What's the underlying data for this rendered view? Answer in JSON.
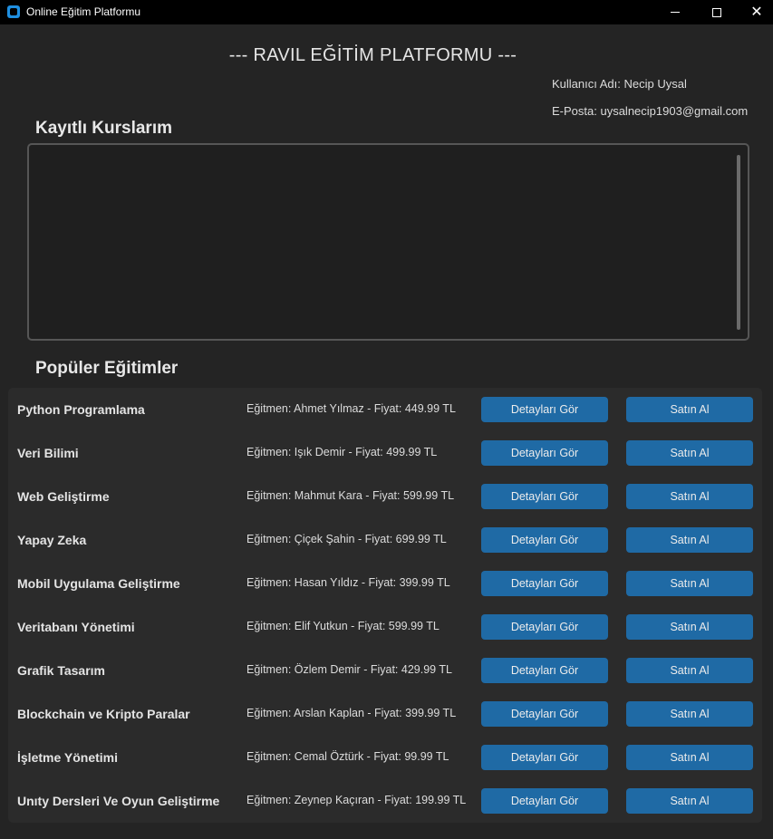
{
  "window": {
    "title": "Online Eğitim Platformu",
    "minimize_icon": "minimize-icon",
    "maximize_icon": "maximize-icon",
    "close_icon": "close-icon",
    "close_glyph": "✕"
  },
  "header": {
    "title": "--- RAVIL EĞİTİM PLATFORMU ---",
    "username_label": "Kullanıcı Adı: Necip  Uysal",
    "email_label": "E-Posta: uysalnecip1903@gmail.com"
  },
  "enrolled": {
    "title": "Kayıtlı Kurslarım"
  },
  "popular": {
    "title": "Popüler Eğitimler",
    "details_label": "Detayları Gör",
    "buy_label": "Satın Al",
    "courses": [
      {
        "name": "Python Programlama",
        "info": "Eğitmen: Ahmet Yılmaz - Fiyat: 449.99 TL"
      },
      {
        "name": "Veri Bilimi",
        "info": "Eğitmen: Işık Demir - Fiyat: 499.99 TL"
      },
      {
        "name": "Web Geliştirme",
        "info": "Eğitmen: Mahmut Kara - Fiyat: 599.99 TL"
      },
      {
        "name": "Yapay Zeka",
        "info": "Eğitmen: Çiçek Şahin - Fiyat: 699.99 TL"
      },
      {
        "name": "Mobil Uygulama Geliştirme",
        "info": "Eğitmen: Hasan Yıldız - Fiyat: 399.99 TL"
      },
      {
        "name": "Veritabanı Yönetimi",
        "info": "Eğitmen: Elif Yutkun - Fiyat: 599.99 TL"
      },
      {
        "name": "Grafik Tasarım",
        "info": "Eğitmen: Özlem Demir - Fiyat: 429.99 TL"
      },
      {
        "name": "Blockchain ve Kripto Paralar",
        "info": "Eğitmen: Arslan Kaplan - Fiyat: 399.99 TL"
      },
      {
        "name": "İşletme Yönetimi",
        "info": "Eğitmen: Cemal Öztürk - Fiyat: 99.99 TL"
      },
      {
        "name": "Unıty Dersleri Ve Oyun Geliştirme",
        "info": "Eğitmen: Zeynep Kaçıran - Fiyat: 199.99 TL"
      }
    ]
  },
  "colors": {
    "background": "#242424",
    "panel": "#2b2b2b",
    "button": "#1f6aa5",
    "titlebar": "#000000"
  }
}
